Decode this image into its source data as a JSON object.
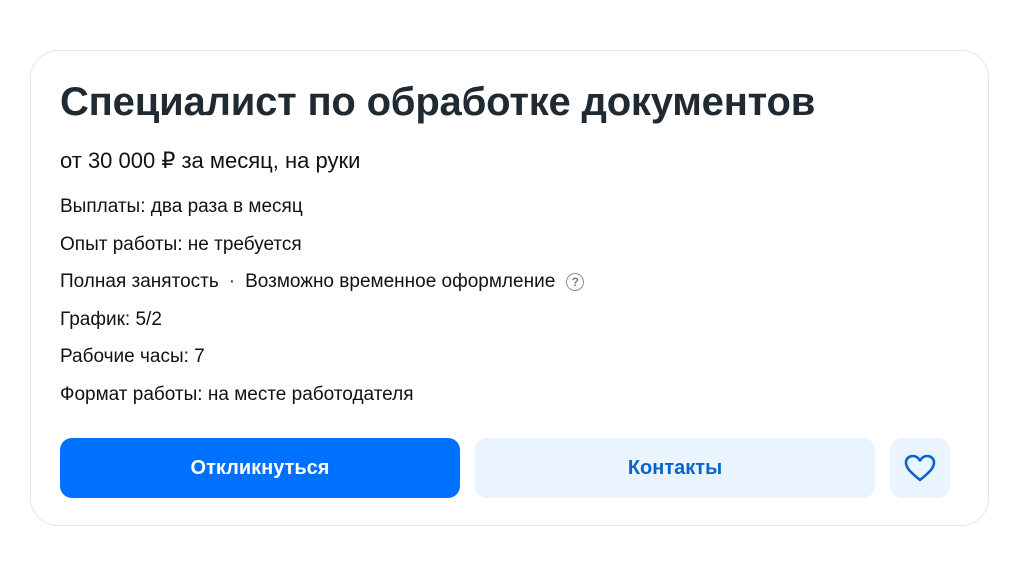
{
  "vacancy": {
    "title": "Специалист по обработке документов",
    "salary": "от 30 000 ₽ за месяц, на руки",
    "details": {
      "payments": "Выплаты: два раза в месяц",
      "experience": "Опыт работы: не требуется",
      "employment": "Полная занятость",
      "separator": "·",
      "temporary": "Возможно временное оформление",
      "schedule": "График: 5/2",
      "hours": "Рабочие часы: 7",
      "format": "Формат работы: на месте работодателя"
    },
    "help_icon": "question-circle-icon"
  },
  "actions": {
    "respond_label": "Откликнуться",
    "contacts_label": "Контакты",
    "favorite_icon": "heart-icon"
  },
  "colors": {
    "primary": "#0070ff",
    "secondary_bg": "#eaf4ff",
    "secondary_text": "#0a63c9",
    "title": "#1f2a33"
  }
}
